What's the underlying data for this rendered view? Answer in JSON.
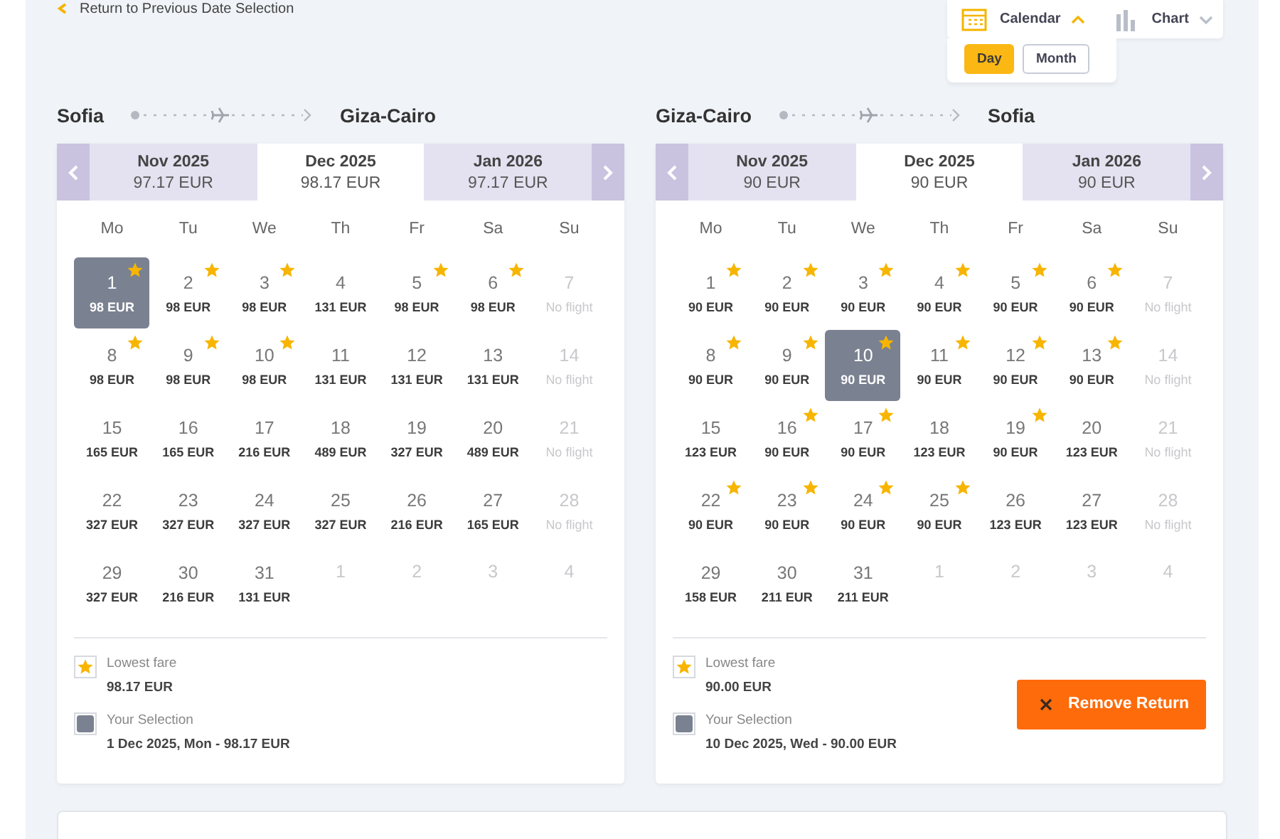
{
  "back_link": {
    "label": "Return to Previous Date Selection"
  },
  "view_switch": {
    "options": [
      {
        "label": "Calendar",
        "kind": "calendar",
        "selected": true,
        "expanded": true
      },
      {
        "label": "Chart",
        "kind": "chart",
        "selected": false,
        "expanded": false
      }
    ],
    "modes": [
      {
        "label": "Day",
        "selected": true
      },
      {
        "label": "Month",
        "selected": false
      }
    ]
  },
  "calendars": [
    {
      "origin": "Sofia",
      "destination": "Giza-Cairo",
      "months": [
        {
          "label": "Nov 2025",
          "price": "97.17 EUR",
          "selected": false
        },
        {
          "label": "Dec 2025",
          "price": "98.17 EUR",
          "selected": true
        },
        {
          "label": "Jan 2026",
          "price": "97.17 EUR",
          "selected": false
        }
      ],
      "weekdays": [
        "Mo",
        "Tu",
        "We",
        "Th",
        "Fr",
        "Sa",
        "Su"
      ],
      "days": [
        {
          "d": "1",
          "price": "98 EUR",
          "kind": "day",
          "star": true,
          "selected": true
        },
        {
          "d": "2",
          "price": "98 EUR",
          "kind": "day",
          "star": true,
          "selected": false
        },
        {
          "d": "3",
          "price": "98 EUR",
          "kind": "day",
          "star": true,
          "selected": false
        },
        {
          "d": "4",
          "price": "131 EUR",
          "kind": "day",
          "star": false,
          "selected": false
        },
        {
          "d": "5",
          "price": "98 EUR",
          "kind": "day",
          "star": true,
          "selected": false
        },
        {
          "d": "6",
          "price": "98 EUR",
          "kind": "day",
          "star": true,
          "selected": false
        },
        {
          "d": "7",
          "price": "No flight",
          "kind": "noflight",
          "star": false,
          "selected": false
        },
        {
          "d": "8",
          "price": "98 EUR",
          "kind": "day",
          "star": true,
          "selected": false
        },
        {
          "d": "9",
          "price": "98 EUR",
          "kind": "day",
          "star": true,
          "selected": false
        },
        {
          "d": "10",
          "price": "98 EUR",
          "kind": "day",
          "star": true,
          "selected": false
        },
        {
          "d": "11",
          "price": "131 EUR",
          "kind": "day",
          "star": false,
          "selected": false
        },
        {
          "d": "12",
          "price": "131 EUR",
          "kind": "day",
          "star": false,
          "selected": false
        },
        {
          "d": "13",
          "price": "131 EUR",
          "kind": "day",
          "star": false,
          "selected": false
        },
        {
          "d": "14",
          "price": "No flight",
          "kind": "noflight",
          "star": false,
          "selected": false
        },
        {
          "d": "15",
          "price": "165 EUR",
          "kind": "day",
          "star": false,
          "selected": false
        },
        {
          "d": "16",
          "price": "165 EUR",
          "kind": "day",
          "star": false,
          "selected": false
        },
        {
          "d": "17",
          "price": "216 EUR",
          "kind": "day",
          "star": false,
          "selected": false
        },
        {
          "d": "18",
          "price": "489 EUR",
          "kind": "day",
          "star": false,
          "selected": false
        },
        {
          "d": "19",
          "price": "327 EUR",
          "kind": "day",
          "star": false,
          "selected": false
        },
        {
          "d": "20",
          "price": "489 EUR",
          "kind": "day",
          "star": false,
          "selected": false
        },
        {
          "d": "21",
          "price": "No flight",
          "kind": "noflight",
          "star": false,
          "selected": false
        },
        {
          "d": "22",
          "price": "327 EUR",
          "kind": "day",
          "star": false,
          "selected": false
        },
        {
          "d": "23",
          "price": "327 EUR",
          "kind": "day",
          "star": false,
          "selected": false
        },
        {
          "d": "24",
          "price": "327 EUR",
          "kind": "day",
          "star": false,
          "selected": false
        },
        {
          "d": "25",
          "price": "327 EUR",
          "kind": "day",
          "star": false,
          "selected": false
        },
        {
          "d": "26",
          "price": "216 EUR",
          "kind": "day",
          "star": false,
          "selected": false
        },
        {
          "d": "27",
          "price": "165 EUR",
          "kind": "day",
          "star": false,
          "selected": false
        },
        {
          "d": "28",
          "price": "No flight",
          "kind": "noflight",
          "star": false,
          "selected": false
        },
        {
          "d": "29",
          "price": "327 EUR",
          "kind": "day",
          "star": false,
          "selected": false
        },
        {
          "d": "30",
          "price": "216 EUR",
          "kind": "day",
          "star": false,
          "selected": false
        },
        {
          "d": "31",
          "price": "131 EUR",
          "kind": "day",
          "star": false,
          "selected": false
        },
        {
          "d": "1",
          "kind": "other",
          "star": false,
          "selected": false
        },
        {
          "d": "2",
          "kind": "other",
          "star": false,
          "selected": false
        },
        {
          "d": "3",
          "kind": "other",
          "star": false,
          "selected": false
        },
        {
          "d": "4",
          "kind": "other",
          "star": false,
          "selected": false
        }
      ],
      "legend": {
        "lowest_label": "Lowest fare",
        "lowest_value": "98.17 EUR",
        "selection_label": "Your Selection",
        "selection_value": "1 Dec 2025, Mon - 98.17 EUR"
      }
    },
    {
      "origin": "Giza-Cairo",
      "destination": "Sofia",
      "months": [
        {
          "label": "Nov 2025",
          "price": "90 EUR",
          "selected": false
        },
        {
          "label": "Dec 2025",
          "price": "90 EUR",
          "selected": true
        },
        {
          "label": "Jan 2026",
          "price": "90 EUR",
          "selected": false
        }
      ],
      "weekdays": [
        "Mo",
        "Tu",
        "We",
        "Th",
        "Fr",
        "Sa",
        "Su"
      ],
      "days": [
        {
          "d": "1",
          "price": "90 EUR",
          "kind": "day",
          "star": true,
          "selected": false
        },
        {
          "d": "2",
          "price": "90 EUR",
          "kind": "day",
          "star": true,
          "selected": false
        },
        {
          "d": "3",
          "price": "90 EUR",
          "kind": "day",
          "star": true,
          "selected": false
        },
        {
          "d": "4",
          "price": "90 EUR",
          "kind": "day",
          "star": true,
          "selected": false
        },
        {
          "d": "5",
          "price": "90 EUR",
          "kind": "day",
          "star": true,
          "selected": false
        },
        {
          "d": "6",
          "price": "90 EUR",
          "kind": "day",
          "star": true,
          "selected": false
        },
        {
          "d": "7",
          "price": "No flight",
          "kind": "noflight",
          "star": false,
          "selected": false
        },
        {
          "d": "8",
          "price": "90 EUR",
          "kind": "day",
          "star": true,
          "selected": false
        },
        {
          "d": "9",
          "price": "90 EUR",
          "kind": "day",
          "star": true,
          "selected": false
        },
        {
          "d": "10",
          "price": "90 EUR",
          "kind": "day",
          "star": true,
          "selected": true
        },
        {
          "d": "11",
          "price": "90 EUR",
          "kind": "day",
          "star": true,
          "selected": false
        },
        {
          "d": "12",
          "price": "90 EUR",
          "kind": "day",
          "star": true,
          "selected": false
        },
        {
          "d": "13",
          "price": "90 EUR",
          "kind": "day",
          "star": true,
          "selected": false
        },
        {
          "d": "14",
          "price": "No flight",
          "kind": "noflight",
          "star": false,
          "selected": false
        },
        {
          "d": "15",
          "price": "123 EUR",
          "kind": "day",
          "star": false,
          "selected": false
        },
        {
          "d": "16",
          "price": "90 EUR",
          "kind": "day",
          "star": true,
          "selected": false
        },
        {
          "d": "17",
          "price": "90 EUR",
          "kind": "day",
          "star": true,
          "selected": false
        },
        {
          "d": "18",
          "price": "123 EUR",
          "kind": "day",
          "star": false,
          "selected": false
        },
        {
          "d": "19",
          "price": "90 EUR",
          "kind": "day",
          "star": true,
          "selected": false
        },
        {
          "d": "20",
          "price": "123 EUR",
          "kind": "day",
          "star": false,
          "selected": false
        },
        {
          "d": "21",
          "price": "No flight",
          "kind": "noflight",
          "star": false,
          "selected": false
        },
        {
          "d": "22",
          "price": "90 EUR",
          "kind": "day",
          "star": true,
          "selected": false
        },
        {
          "d": "23",
          "price": "90 EUR",
          "kind": "day",
          "star": true,
          "selected": false
        },
        {
          "d": "24",
          "price": "90 EUR",
          "kind": "day",
          "star": true,
          "selected": false
        },
        {
          "d": "25",
          "price": "90 EUR",
          "kind": "day",
          "star": true,
          "selected": false
        },
        {
          "d": "26",
          "price": "123 EUR",
          "kind": "day",
          "star": false,
          "selected": false
        },
        {
          "d": "27",
          "price": "123 EUR",
          "kind": "day",
          "star": false,
          "selected": false
        },
        {
          "d": "28",
          "price": "No flight",
          "kind": "noflight",
          "star": false,
          "selected": false
        },
        {
          "d": "29",
          "price": "158 EUR",
          "kind": "day",
          "star": false,
          "selected": false
        },
        {
          "d": "30",
          "price": "211 EUR",
          "kind": "day",
          "star": false,
          "selected": false
        },
        {
          "d": "31",
          "price": "211 EUR",
          "kind": "day",
          "star": false,
          "selected": false
        },
        {
          "d": "1",
          "kind": "other",
          "star": false,
          "selected": false
        },
        {
          "d": "2",
          "kind": "other",
          "star": false,
          "selected": false
        },
        {
          "d": "3",
          "kind": "other",
          "star": false,
          "selected": false
        },
        {
          "d": "4",
          "kind": "other",
          "star": false,
          "selected": false
        }
      ],
      "legend": {
        "lowest_label": "Lowest fare",
        "lowest_value": "90.00 EUR",
        "selection_label": "Your Selection",
        "selection_value": "10 Dec 2025, Wed - 90.00 EUR"
      },
      "action": {
        "label": "Remove Return"
      }
    }
  ]
}
